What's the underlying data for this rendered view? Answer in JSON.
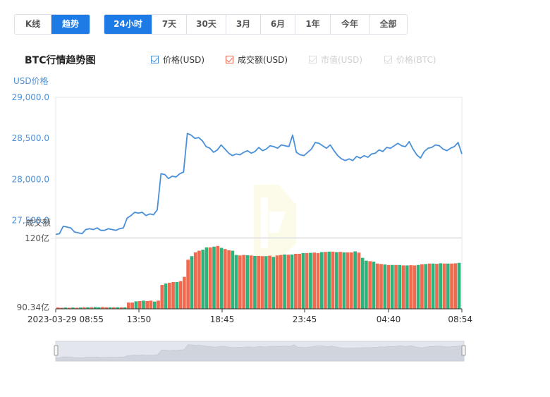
{
  "chart_type_tabs": [
    {
      "label": "K线",
      "active": false
    },
    {
      "label": "趋势",
      "active": true
    }
  ],
  "range_tabs": [
    {
      "label": "24小时",
      "active": true
    },
    {
      "label": "7天",
      "active": false
    },
    {
      "label": "30天",
      "active": false
    },
    {
      "label": "3月",
      "active": false
    },
    {
      "label": "6月",
      "active": false
    },
    {
      "label": "1年",
      "active": false
    },
    {
      "label": "今年",
      "active": false
    },
    {
      "label": "全部",
      "active": false
    }
  ],
  "title": "BTC行情趋势图",
  "legend": [
    {
      "label": "价格(USD)",
      "checked": true,
      "color": "#4a90d9"
    },
    {
      "label": "成交额(USD)",
      "checked": true,
      "color": "#e8664d"
    },
    {
      "label": "市值(USD)",
      "checked": false,
      "color": "#cccccc"
    },
    {
      "label": "价格(BTC)",
      "checked": false,
      "color": "#cccccc"
    }
  ],
  "colors": {
    "price_line": "#4a90d9",
    "bar_up": "#2db37b",
    "bar_down": "#ef6a4f",
    "axis_label": "#4a90d9"
  },
  "chart_data": {
    "type": "line",
    "title": "BTC行情趋势图",
    "x_tick_labels": [
      "2023-03-29 08:55",
      "13:50",
      "18:45",
      "23:45",
      "04:40",
      "08:54"
    ],
    "price": {
      "name": "价格(USD)",
      "ylabel": "USD价格",
      "yticks": [
        27500.0,
        28000.0,
        28500.0,
        29000.0
      ],
      "ytick_labels": [
        "27,500.0",
        "28,000.0",
        "28,500.0",
        "29,000.0"
      ],
      "ylim": [
        27300,
        29000
      ],
      "values": [
        27330,
        27340,
        27430,
        27420,
        27410,
        27360,
        27350,
        27340,
        27390,
        27400,
        27390,
        27410,
        27380,
        27380,
        27400,
        27390,
        27380,
        27400,
        27410,
        27530,
        27560,
        27600,
        27590,
        27600,
        27560,
        27580,
        27570,
        27630,
        28070,
        28060,
        28010,
        28040,
        28030,
        28070,
        28090,
        28560,
        28540,
        28500,
        28510,
        28470,
        28400,
        28380,
        28330,
        28360,
        28420,
        28370,
        28320,
        28290,
        28310,
        28300,
        28330,
        28350,
        28320,
        28340,
        28390,
        28350,
        28370,
        28410,
        28400,
        28380,
        28420,
        28410,
        28400,
        28540,
        28330,
        28300,
        28290,
        28330,
        28370,
        28450,
        28440,
        28410,
        28380,
        28420,
        28350,
        28290,
        28250,
        28230,
        28250,
        28230,
        28280,
        28260,
        28290,
        28270,
        28310,
        28320,
        28360,
        28340,
        28390,
        28380,
        28410,
        28440,
        28410,
        28400,
        28460,
        28370,
        28300,
        28260,
        28340,
        28380,
        28390,
        28420,
        28410,
        28370,
        28350,
        28380,
        28400,
        28450,
        28310
      ]
    },
    "volume": {
      "name": "成交额(USD)",
      "ylabel": "成交额",
      "ytick_labels": [
        "90.34亿",
        "120亿"
      ],
      "ylim": [
        9034000000,
        12000000000
      ],
      "values": [
        9090000000,
        9080000000,
        9090000000,
        9080000000,
        9090000000,
        9080000000,
        9090000000,
        9100000000,
        9100000000,
        9100000000,
        9110000000,
        9100000000,
        9110000000,
        9100000000,
        9100000000,
        9100000000,
        9100000000,
        9100000000,
        9100000000,
        9300000000,
        9300000000,
        9350000000,
        9360000000,
        9380000000,
        9360000000,
        9380000000,
        9340000000,
        9380000000,
        10040000000,
        10100000000,
        10130000000,
        10160000000,
        10160000000,
        10200000000,
        10380000000,
        11100000000,
        11250000000,
        11410000000,
        11480000000,
        11520000000,
        11620000000,
        11620000000,
        11650000000,
        11680000000,
        11600000000,
        11550000000,
        11500000000,
        11480000000,
        11300000000,
        11280000000,
        11300000000,
        11290000000,
        11280000000,
        11260000000,
        11260000000,
        11250000000,
        11250000000,
        11270000000,
        11220000000,
        11280000000,
        11300000000,
        11320000000,
        11310000000,
        11320000000,
        11350000000,
        11350000000,
        11380000000,
        11380000000,
        11390000000,
        11400000000,
        11380000000,
        11420000000,
        11430000000,
        11440000000,
        11440000000,
        11420000000,
        11430000000,
        11410000000,
        11410000000,
        11410000000,
        11450000000,
        11400000000,
        11180000000,
        11060000000,
        11040000000,
        11020000000,
        10940000000,
        10920000000,
        10900000000,
        10880000000,
        10880000000,
        10880000000,
        10880000000,
        10860000000,
        10860000000,
        10870000000,
        10860000000,
        10880000000,
        10910000000,
        10920000000,
        10940000000,
        10940000000,
        10930000000,
        10950000000,
        10940000000,
        10940000000,
        10940000000,
        10950000000,
        10970000000
      ],
      "directions": [
        0,
        0,
        1,
        0,
        1,
        0,
        1,
        0,
        1,
        0,
        1,
        1,
        0,
        0,
        1,
        0,
        1,
        0,
        1,
        0,
        0,
        1,
        0,
        1,
        0,
        0,
        1,
        0,
        0,
        1,
        0,
        0,
        1,
        0,
        0,
        0,
        1,
        0,
        0,
        1,
        1,
        0,
        1,
        0,
        1,
        0,
        0,
        1,
        1,
        0,
        0,
        1,
        0,
        1,
        0,
        0,
        1,
        0,
        1,
        0,
        0,
        1,
        0,
        1,
        0,
        0,
        1,
        0,
        1,
        0,
        0,
        1,
        0,
        1,
        0,
        1,
        0,
        1,
        0,
        0,
        1,
        0,
        1,
        1,
        0,
        1,
        0,
        0,
        1,
        0,
        1,
        0,
        1,
        0,
        1,
        0,
        0,
        1,
        0,
        1,
        0,
        1,
        0,
        1,
        0,
        1,
        0,
        0,
        1
      ]
    }
  }
}
